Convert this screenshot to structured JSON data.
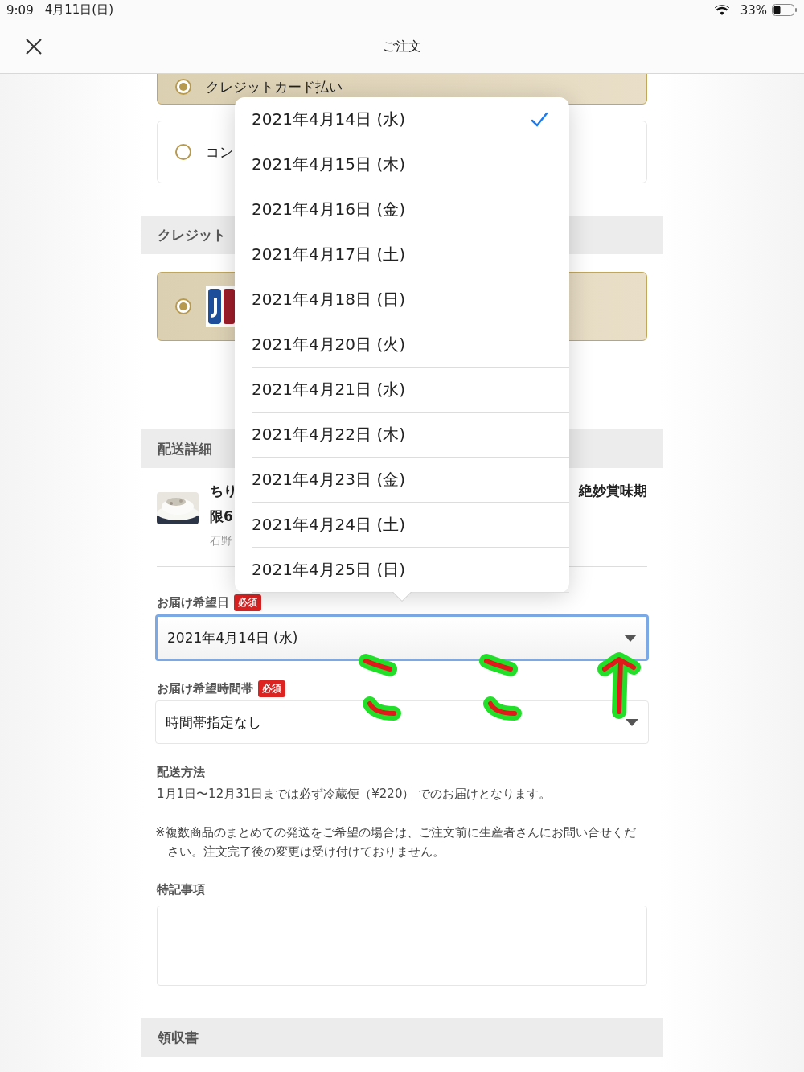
{
  "status_bar": {
    "time": "9:09",
    "date": "4月11日(日)",
    "battery": "33%"
  },
  "header": {
    "title": "ご注文"
  },
  "payment_options": [
    {
      "label": "クレジットカード払い",
      "selected": true
    },
    {
      "label": "コン",
      "selected": false
    }
  ],
  "credit_section": {
    "title": "クレジット",
    "cards": [
      {
        "selected": true
      }
    ]
  },
  "delivery_section": {
    "title": "配送詳細",
    "product": {
      "kind": "picture",
      "title_left": "ちり",
      "title_right": "絶妙賞味期",
      "title_line2": "限6",
      "producer": "石野"
    },
    "date_field": {
      "label": "お届け希望日",
      "badge": "必須",
      "value": "2021年4月14日 (水)",
      "focused": true
    },
    "time_field": {
      "label": "お届け希望時間帯",
      "badge": "必須",
      "value": "時間帯指定なし"
    },
    "method": {
      "title": "配送方法",
      "text": "1月1日〜12月31日までは必ず冷蔵便（¥220） でのお届けとなります。"
    },
    "note": "※複数商品のまとめての発送をご希望の場合は、ご注文前に生産者さんにお問い合せください。注文完了後の変更は受け付けておりません。",
    "remarks": {
      "title": "特記事項"
    }
  },
  "receipt_section": {
    "title": "領収書"
  },
  "date_picker": [
    {
      "label": "2021年4月14日 (水)",
      "selected": true
    },
    {
      "label": "2021年4月15日 (木)",
      "selected": false
    },
    {
      "label": "2021年4月16日 (金)",
      "selected": false
    },
    {
      "label": "2021年4月17日 (土)",
      "selected": false
    },
    {
      "label": "2021年4月18日 (日)",
      "selected": false
    },
    {
      "label": "2021年4月20日 (火)",
      "selected": false
    },
    {
      "label": "2021年4月21日 (水)",
      "selected": false
    },
    {
      "label": "2021年4月22日 (木)",
      "selected": false
    },
    {
      "label": "2021年4月23日 (金)",
      "selected": false
    },
    {
      "label": "2021年4月24日 (土)",
      "selected": false
    },
    {
      "label": "2021年4月25日 (日)",
      "selected": false
    }
  ]
}
